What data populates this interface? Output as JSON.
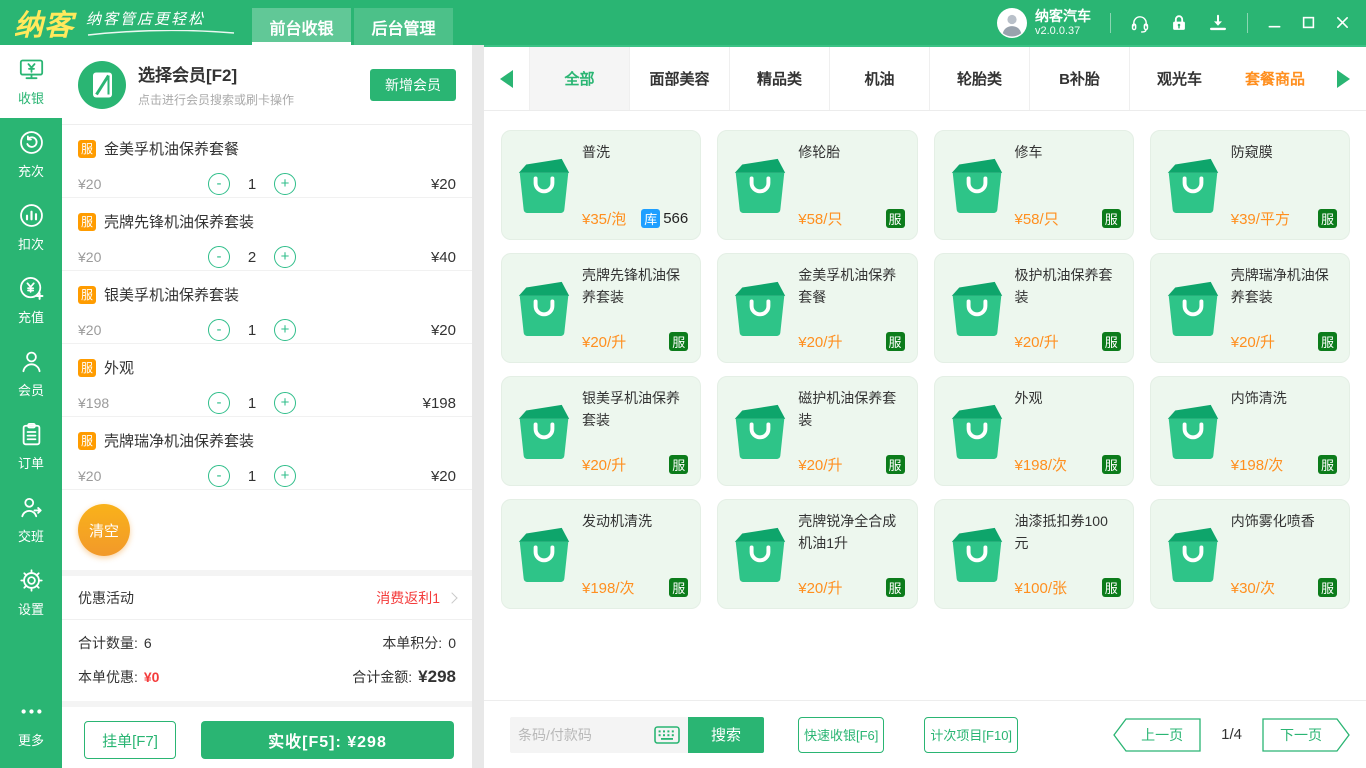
{
  "topbar": {
    "logo": "纳客",
    "slogan": "纳客管店更轻松",
    "tabs": [
      {
        "label": "前台收银",
        "active": true
      },
      {
        "label": "后台管理",
        "active": false
      }
    ],
    "user": {
      "name": "纳客汽车",
      "version": "v2.0.0.37"
    }
  },
  "sidebar": {
    "items": [
      {
        "label": "收银",
        "icon": "cashier-icon",
        "active": true
      },
      {
        "label": "充次",
        "icon": "recharge-times-icon"
      },
      {
        "label": "扣次",
        "icon": "deduct-times-icon"
      },
      {
        "label": "充值",
        "icon": "recharge-icon"
      },
      {
        "label": "会员",
        "icon": "member-icon"
      },
      {
        "label": "订单",
        "icon": "orders-icon"
      },
      {
        "label": "交班",
        "icon": "shift-icon"
      },
      {
        "label": "设置",
        "icon": "settings-icon"
      },
      {
        "label": "更多",
        "icon": "more-icon"
      }
    ]
  },
  "cart": {
    "member": {
      "title": "选择会员[F2]",
      "subtitle": "点击进行会员搜索或刷卡操作",
      "add_button": "新增会员"
    },
    "badge_label": "服",
    "items": [
      {
        "name": "金美孚机油保养套餐",
        "price": "¥20",
        "qty": "1",
        "total": "¥20"
      },
      {
        "name": "壳牌先锋机油保养套装",
        "price": "¥20",
        "qty": "2",
        "total": "¥40"
      },
      {
        "name": "银美孚机油保养套装",
        "price": "¥20",
        "qty": "1",
        "total": "¥20"
      },
      {
        "name": "外观",
        "price": "¥198",
        "qty": "1",
        "total": "¥198"
      },
      {
        "name": "壳牌瑞净机油保养套装",
        "price": "¥20",
        "qty": "1",
        "total": "¥20"
      }
    ],
    "clear_button": "清空",
    "promo": {
      "label": "优惠活动",
      "value": "消费返利1"
    },
    "summary": {
      "qty_label": "合计数量:",
      "qty": "6",
      "points_label": "本单积分:",
      "points": "0",
      "discount_label": "本单优惠:",
      "discount": "¥0",
      "total_label": "合计金额:",
      "total": "¥298"
    },
    "hold_button": "挂单[F7]",
    "pay_button": "实收[F5]:  ¥298"
  },
  "catalog": {
    "categories": [
      {
        "label": "全部",
        "active": true
      },
      {
        "label": "面部美容"
      },
      {
        "label": "精品类"
      },
      {
        "label": "机油"
      },
      {
        "label": "轮胎类"
      },
      {
        "label": "B补胎"
      },
      {
        "label": "观光车"
      },
      {
        "label": "套餐商品",
        "highlight": true
      }
    ],
    "stock_badge_label": "库",
    "service_badge_label": "服",
    "products": [
      {
        "name": "普洗",
        "price": "¥35/泡",
        "stock": "566"
      },
      {
        "name": "修轮胎",
        "price": "¥58/只",
        "service": true
      },
      {
        "name": "修车",
        "price": "¥58/只",
        "service": true
      },
      {
        "name": "防窥膜",
        "price": "¥39/平方",
        "service": true
      },
      {
        "name": "壳牌先锋机油保养套装",
        "price": "¥20/升",
        "service": true
      },
      {
        "name": "金美孚机油保养套餐",
        "price": "¥20/升",
        "service": true
      },
      {
        "name": "极护机油保养套装",
        "price": "¥20/升",
        "service": true
      },
      {
        "name": "壳牌瑞净机油保养套装",
        "price": "¥20/升",
        "service": true
      },
      {
        "name": "银美孚机油保养套装",
        "price": "¥20/升",
        "service": true
      },
      {
        "name": "磁护机油保养套装",
        "price": "¥20/升",
        "service": true
      },
      {
        "name": "外观",
        "price": "¥198/次",
        "service": true
      },
      {
        "name": "内饰清洗",
        "price": "¥198/次",
        "service": true
      },
      {
        "name": "发动机清洗",
        "price": "¥198/次",
        "service": true
      },
      {
        "name": "壳牌锐净全合成机油1升",
        "price": "¥20/升",
        "service": true
      },
      {
        "name": "油漆抵扣券100元",
        "price": "¥100/张",
        "service": true
      },
      {
        "name": "内饰雾化喷香",
        "price": "¥30/次",
        "service": true
      }
    ],
    "footer": {
      "search_placeholder": "条码/付款码",
      "search_button": "搜索",
      "quick_button": "快速收银[F6]",
      "count_button": "计次项目[F10]",
      "prev": "上一页",
      "page": "1/4",
      "next": "下一页"
    }
  },
  "colors": {
    "accent_green": "#2ab573",
    "dark_service_green": "#0c7c1b",
    "stock_blue": "#1e9fff",
    "price_orange": "#ff8f1f",
    "badge_orange": "#ff9c00",
    "danger_red": "#f43b3b",
    "card_bg_green": "#edf7ee"
  }
}
